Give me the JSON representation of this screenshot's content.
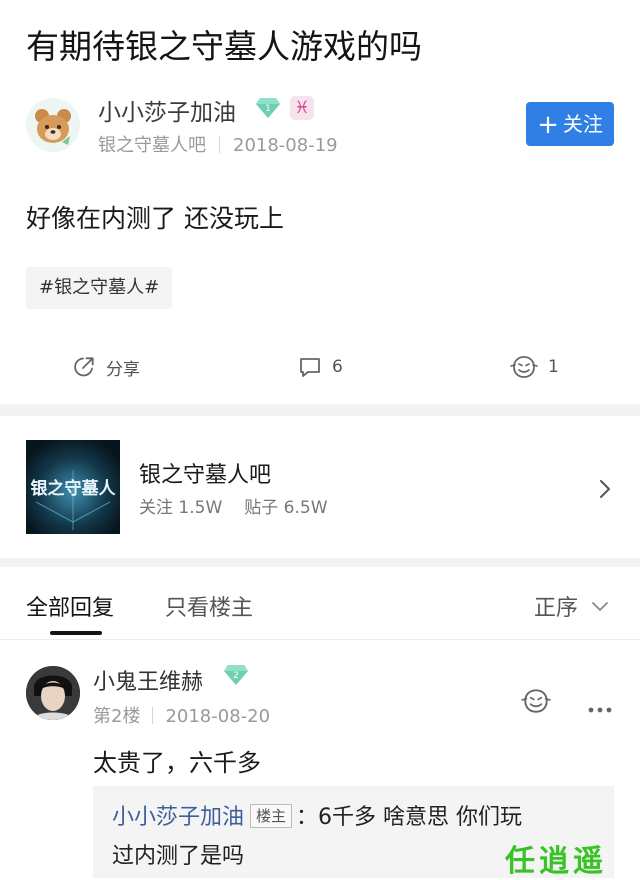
{
  "post": {
    "title": "有期待银之守墓人游戏的吗",
    "author": "小小莎子加油",
    "author_level": "1",
    "zodiac_glyph": "♓",
    "forum_name": "银之守墓人吧",
    "date": "2018-08-19",
    "follow_label": "关注",
    "body": "好像在内测了 还没玩上",
    "tag": "#银之守墓人#"
  },
  "actions": {
    "share_label": "分享",
    "comment_count": "6",
    "like_count": "1"
  },
  "forum_card": {
    "cover_text": "银之守墓人",
    "name": "银之守墓人吧",
    "followers_label": "关注",
    "followers": "1.5W",
    "posts_label": "贴子",
    "posts": "6.5W"
  },
  "tabs": {
    "all_replies": "全部回复",
    "op_only": "只看楼主",
    "sort_label": "正序"
  },
  "reply": {
    "author": "小鬼王维赫",
    "level": "2",
    "floor": "第2楼",
    "date": "2018-08-20",
    "text": "太贵了，六千多",
    "quote_user": "小小莎子加油",
    "quote_badge": "楼主",
    "quote_text_line1": "6千多 啥意思 你们玩",
    "quote_text_line2": "过内测了是吗"
  },
  "watermark": "任逍遥",
  "colors": {
    "accent_blue": "#2f7fe5",
    "gem_green": "#6fcfb3",
    "watermark_green": "#39c225"
  }
}
